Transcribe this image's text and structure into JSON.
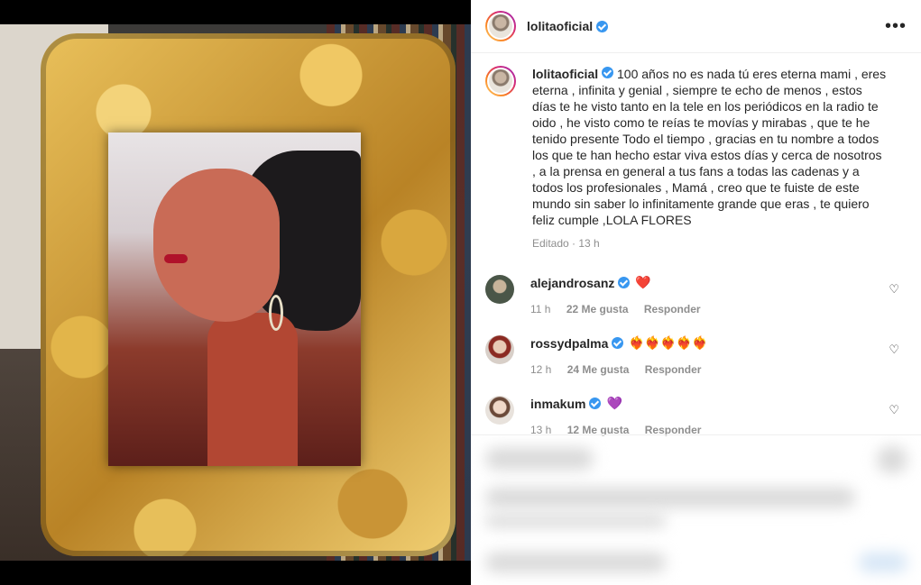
{
  "post": {
    "author": "lolitaoficial",
    "more_label": "•••",
    "caption_user": "lolitaoficial",
    "caption_text": "100 años no es nada tú eres eterna mami , eres eterna , infinita y genial , siempre te echo de menos , estos días te he visto tanto en la tele en los periódicos en la radio te oido , he visto como te reías te movías y mirabas , que te he tenido presente Todo el tiempo , gracias en tu nombre a todos los que te han hecho estar viva estos días y cerca de nosotros , a la prensa en general a tus fans a todas las cadenas y a todos los profesionales , Mamá , creo que te fuiste de este mundo sin saber lo infinitamente grande que eras , te quiero feliz cumple ,LOLA FLORES",
    "edited_label": "Editado · 13 h"
  },
  "comments": [
    {
      "user": "alejandrosanz",
      "text": "❤️",
      "time": "11 h",
      "likes": "22 Me gusta",
      "reply": "Responder",
      "avatar_color": "#5a6a58"
    },
    {
      "user": "rossydpalma",
      "text": "❤️‍🔥❤️‍🔥❤️‍🔥❤️‍🔥❤️‍🔥",
      "time": "12 h",
      "likes": "24 Me gusta",
      "reply": "Responder",
      "avatar_color": "#c0392b"
    },
    {
      "user": "inmakum",
      "text": "💜",
      "time": "13 h",
      "likes": "12 Me gusta",
      "reply": "Responder",
      "avatar_color": "#d9c2b0"
    }
  ],
  "icons": {
    "heart": "♡",
    "verified": "verified-badge-icon"
  }
}
